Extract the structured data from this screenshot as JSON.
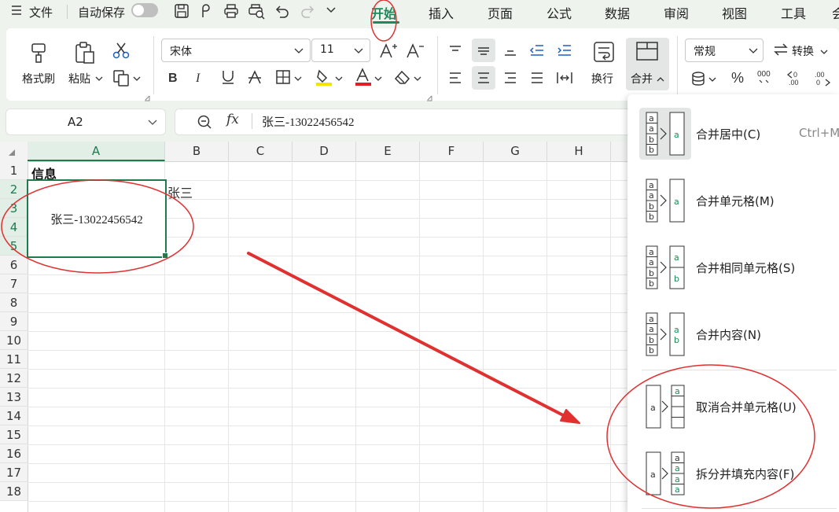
{
  "menubar": {
    "file_label": "文件",
    "autosave_label": "自动保存",
    "tabs": [
      "开始",
      "插入",
      "页面",
      "公式",
      "数据",
      "审阅",
      "视图",
      "工具"
    ],
    "active_tab": "开始",
    "cutoff_tab": "会"
  },
  "ribbon": {
    "format_painter": "格式刷",
    "paste": "粘贴",
    "font_name": "宋体",
    "font_size": "11",
    "wrap_text": "换行",
    "merge": "合并",
    "number_format": "常规",
    "convert": "转换"
  },
  "formula_bar": {
    "cell_ref": "A2",
    "fx": "fx",
    "content": "张三-13022456542"
  },
  "sheet": {
    "columns": [
      "A",
      "B",
      "C",
      "D",
      "E",
      "F",
      "G",
      "H"
    ],
    "rows": [
      "1",
      "2",
      "3",
      "4",
      "5",
      "6",
      "7",
      "8",
      "9",
      "10",
      "11",
      "12",
      "13",
      "14",
      "15",
      "16",
      "17",
      "18"
    ],
    "a1": "信息",
    "a2_merged": "张三-13022456542",
    "b2": "张三"
  },
  "merge_menu": {
    "items": [
      {
        "label": "合并居中(C)",
        "shortcut": "Ctrl+M"
      },
      {
        "label": "合并单元格(M)"
      },
      {
        "label": "合并相同单元格(S)"
      },
      {
        "label": "合并内容(N)"
      },
      {
        "label": "取消合并单元格(U)"
      },
      {
        "label": "拆分并填充内容(F)"
      }
    ],
    "icon_letters": [
      "a",
      "b"
    ]
  },
  "colors": {
    "accent_green": "#1d8a5b",
    "annotation_red": "#e03030",
    "selection_border": "#1f7a4c"
  }
}
